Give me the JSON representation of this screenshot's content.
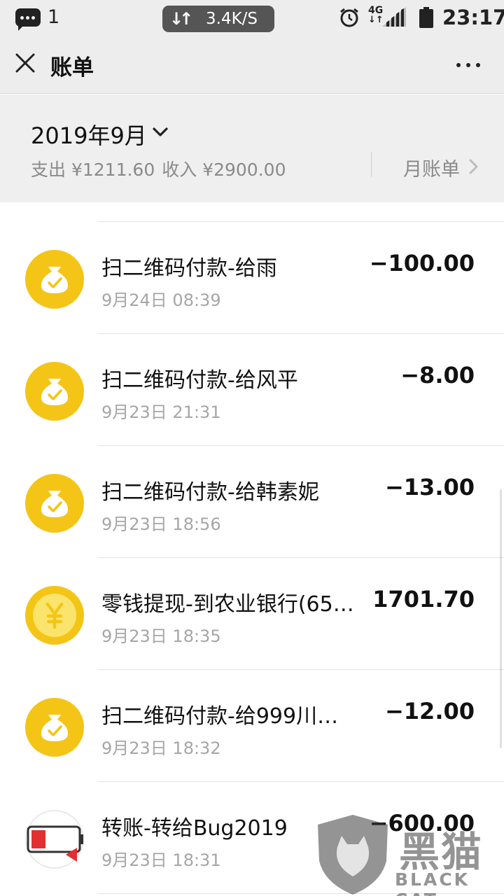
{
  "status_bar": {
    "notification_count": "1",
    "net_speed": "3.4K/S",
    "network": "4G",
    "time": "23:17"
  },
  "nav": {
    "title": "账单",
    "close_icon": "close-icon",
    "more_icon": "more-icon"
  },
  "summary": {
    "month": "2019年9月",
    "expense": "支出 ¥1211.60",
    "income": "收入 ¥2900.00",
    "monthly_bill": "月账单"
  },
  "transactions": [
    {
      "title": "扫二维码付款-给雨",
      "time": "9月24日 08:39",
      "amount": "−100.00",
      "icon": "money-bag-icon"
    },
    {
      "title": "扫二维码付款-给风平",
      "time": "9月23日 21:31",
      "amount": "−8.00",
      "icon": "money-bag-icon"
    },
    {
      "title": "扫二维码付款-给韩素妮",
      "time": "9月23日 18:56",
      "amount": "−13.00",
      "icon": "money-bag-icon"
    },
    {
      "title": "零钱提现-到农业银行(65…",
      "time": "9月23日 18:35",
      "amount": "1701.70",
      "icon": "yuan-coin-icon"
    },
    {
      "title": "扫二维码付款-给999川…",
      "time": "9月23日 18:32",
      "amount": "−12.00",
      "icon": "money-bag-icon"
    },
    {
      "title": "转账-转给Bug2019",
      "time": "9月23日 18:31",
      "amount": "−600.00",
      "icon": "avatar-icon"
    }
  ],
  "watermark": {
    "cn": "黑猫",
    "en": "BLACK CAT"
  },
  "colors": {
    "coin_yellow": "#f4c517",
    "background_gray": "#ededed"
  }
}
